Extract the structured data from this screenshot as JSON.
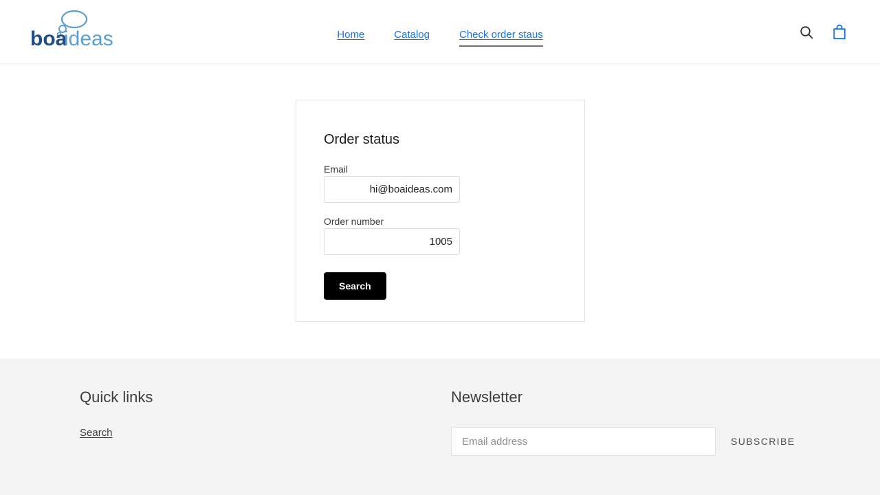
{
  "header": {
    "logo": {
      "name": "boaideas",
      "text_dark": "boa",
      "text_light": "ideas",
      "color_dark": "#1f4e87",
      "color_light": "#5a9fd4"
    },
    "nav": [
      {
        "label": "Home",
        "active": false
      },
      {
        "label": "Catalog",
        "active": false
      },
      {
        "label": "Check order staus",
        "active": true
      }
    ],
    "nav_link_color": "#1773ea",
    "actions": [
      {
        "icon": "search-icon",
        "color": "#2b2c2d"
      },
      {
        "icon": "shopping-bag-icon",
        "color": "#1773ea"
      }
    ]
  },
  "main": {
    "card": {
      "title": "Order status",
      "fields": [
        {
          "label": "Email",
          "value": "hi@boaideas.com",
          "placeholder": ""
        },
        {
          "label": "Order number",
          "value": "1005",
          "placeholder": ""
        }
      ],
      "submit_label": "Search",
      "submit_bg": "#000000"
    }
  },
  "footer": {
    "background": "#f4f4f4",
    "quick_links": {
      "heading": "Quick links",
      "items": [
        {
          "label": "Search"
        }
      ]
    },
    "newsletter": {
      "heading": "Newsletter",
      "input_value": "",
      "input_placeholder": "Email address",
      "subscribe_label": "SUBSCRIBE"
    }
  }
}
